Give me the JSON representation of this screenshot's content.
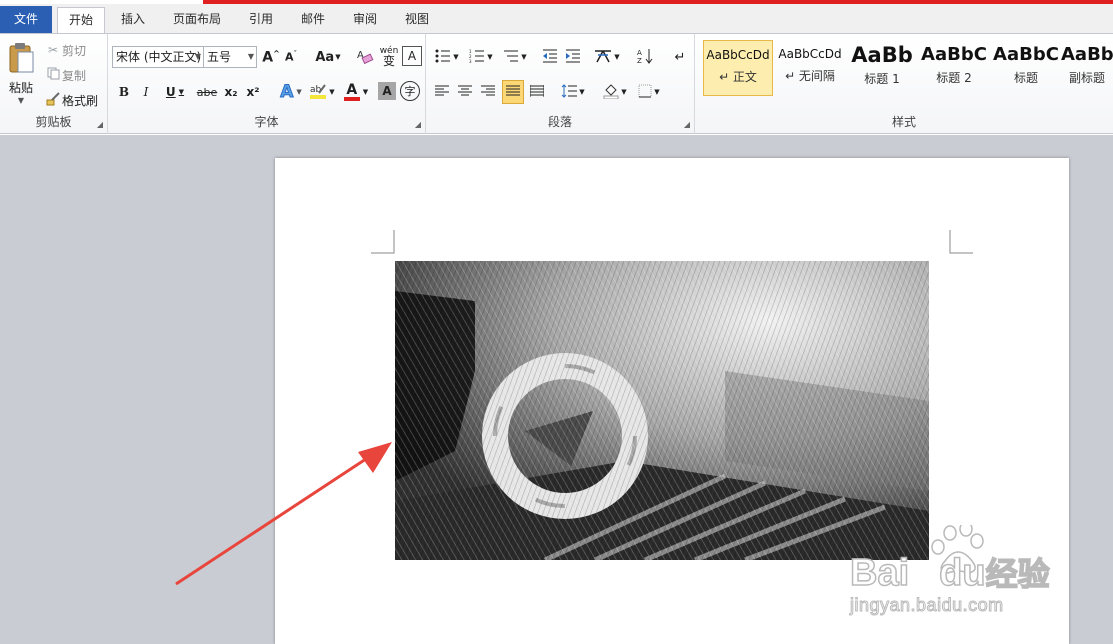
{
  "colors": {
    "file_tab_bg": "#2b5fb4",
    "accent_red": "#e02020",
    "font_color_swatch": "#e02020",
    "highlight_swatch": "#f3e53a",
    "selected_style_bg": "#fdeeb0"
  },
  "tabs": [
    {
      "label": "文件"
    },
    {
      "label": "开始"
    },
    {
      "label": "插入"
    },
    {
      "label": "页面布局"
    },
    {
      "label": "引用"
    },
    {
      "label": "邮件"
    },
    {
      "label": "审阅"
    },
    {
      "label": "视图"
    }
  ],
  "clipboard": {
    "group_label": "剪贴板",
    "paste_label": "粘贴",
    "cut_label": "剪切",
    "copy_label": "复制",
    "format_painter_label": "格式刷"
  },
  "font": {
    "group_label": "字体",
    "font_name": "宋体 (中文正文)",
    "font_size": "五号",
    "change_case_label": "Aa",
    "bold": "B",
    "italic": "I",
    "underline": "U",
    "strikethrough": "abe",
    "subscript": "x₂",
    "superscript": "x²",
    "text_effect": "A",
    "font_color": "A",
    "char_shading": "A",
    "enclose": "字",
    "phonetic": "wén",
    "phonetic_char": "变",
    "char_border": "A"
  },
  "paragraph": {
    "group_label": "段落"
  },
  "styles": {
    "group_label": "样式",
    "items": [
      {
        "sample": "AaBbCcDd",
        "name": "↵ 正文"
      },
      {
        "sample": "AaBbCcDd",
        "name": "↵ 无间隔"
      },
      {
        "sample": "AaBb",
        "name": "标题 1"
      },
      {
        "sample": "AaBbC",
        "name": "标题 2"
      },
      {
        "sample": "AaBbC",
        "name": "标题"
      },
      {
        "sample": "AaBb",
        "name": "副标题"
      }
    ]
  },
  "watermark": {
    "brand": "Bai",
    "brand2": "du",
    "product": "经验",
    "url": "jingyan.baidu.com"
  }
}
